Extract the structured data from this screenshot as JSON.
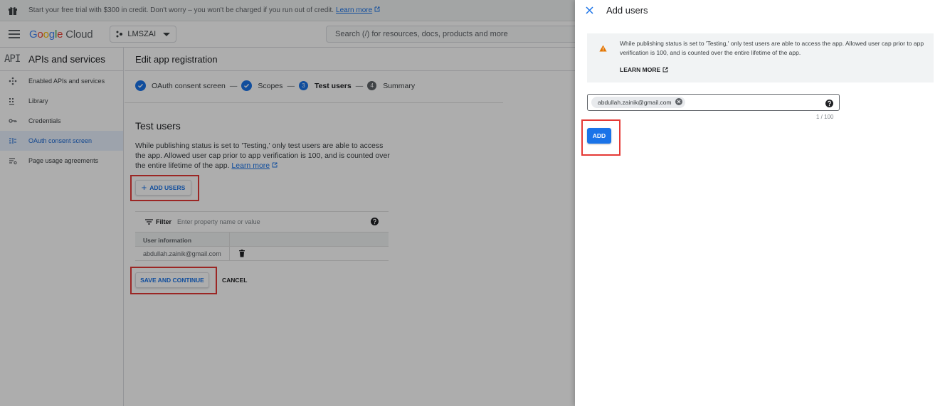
{
  "topbar": {
    "trial_text": "Start your free trial with $300 in credit. Don't worry – you won't be charged if you run out of credit.",
    "learn_more": "Learn more"
  },
  "header": {
    "logo_google": [
      "G",
      "o",
      "o",
      "g",
      "l",
      "e"
    ],
    "logo_cloud": "Cloud",
    "project": "LMSZAI",
    "search_placeholder": "Search (/) for resources, docs, products and more"
  },
  "sidebar": {
    "badge": "API",
    "title": "APIs and services",
    "items": [
      {
        "label": "Enabled APIs and services",
        "icon": "enabled-apis-icon"
      },
      {
        "label": "Library",
        "icon": "library-icon"
      },
      {
        "label": "Credentials",
        "icon": "key-icon"
      },
      {
        "label": "OAuth consent screen",
        "icon": "consent-icon",
        "active": true
      },
      {
        "label": "Page usage agreements",
        "icon": "agreements-icon"
      }
    ]
  },
  "main": {
    "page_title": "Edit app registration",
    "steps": [
      {
        "label": "OAuth consent screen",
        "state": "done"
      },
      {
        "label": "Scopes",
        "state": "done"
      },
      {
        "number": "3",
        "label": "Test users",
        "state": "current"
      },
      {
        "number": "4",
        "label": "Summary",
        "state": "pending"
      }
    ],
    "step_separator": "—",
    "section_title": "Test users",
    "description": "While publishing status is set to 'Testing,' only test users are able to access the app. Allowed user cap prior to app verification is 100, and is counted over the entire lifetime of the app.",
    "learn_more": "Learn more",
    "add_users_label": "ADD USERS",
    "filter_label": "Filter",
    "filter_placeholder": "Enter property name or value",
    "table_header": "User information",
    "rows": [
      {
        "email": "abdullah.zainik@gmail.com"
      }
    ],
    "save_label": "SAVE AND CONTINUE",
    "cancel_label": "CANCEL"
  },
  "panel": {
    "title": "Add users",
    "info_text": "While publishing status is set to 'Testing,' only test users are able to access the app. Allowed user cap prior to app verification is 100, and is counted over the entire lifetime of the app.",
    "info_link": "LEARN MORE",
    "chip_email": "abdullah.zainik@gmail.com",
    "counter": "1 / 100",
    "add_label": "ADD"
  },
  "colors": {
    "accent": "#1a73e8",
    "highlight": "#e53935",
    "warning": "#e37400"
  }
}
